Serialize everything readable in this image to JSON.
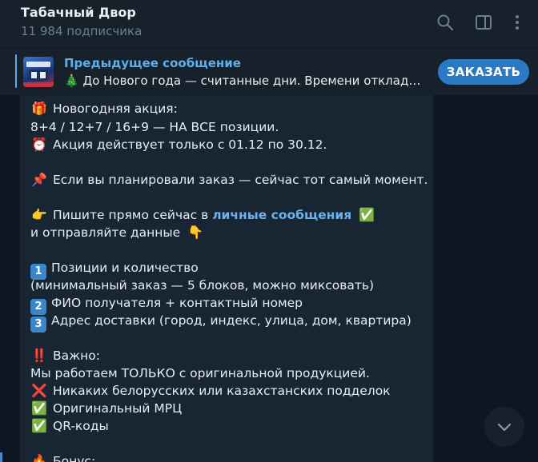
{
  "header": {
    "channel_name": "Табачный Двор",
    "subscribers": "11 984 подписчика",
    "icons": [
      "search-icon",
      "sidebar-toggle-icon",
      "more-vertical-icon"
    ]
  },
  "pinned": {
    "title": "Предыдущее сообщение",
    "emoji": "🎄",
    "preview": "До Нового года — считанные дни. Времени откладывать больше нет",
    "button": "ЗАКАЗАТЬ"
  },
  "message": {
    "l1": {
      "emoji": "🎁",
      "text": "Новогодняя акция:"
    },
    "l2": {
      "text": "8+4 / 12+7 / 16+9 — НА ВСЕ позиции."
    },
    "l3": {
      "emoji": "⏰",
      "text": "Акция действует только с 01.12 по 30.12."
    },
    "l4": {
      "emoji": "📌",
      "text": "Если вы планировали заказ — сейчас тот самый момент."
    },
    "l5": {
      "emoji": "👉",
      "text": "Пишите прямо сейчас в ",
      "link": "личные сообщения",
      "tail_emoji": "✅"
    },
    "l6": {
      "text": "и отправляйте данные",
      "tail_emoji": "👇"
    },
    "l7": {
      "key": "1",
      "text": "Позиции и количество"
    },
    "l8": {
      "text": "(минимальный заказ — 5 блоков, можно миксовать)"
    },
    "l9": {
      "key": "2",
      "text": "ФИО получателя + контактный номер"
    },
    "l10": {
      "key": "3",
      "text": "Адрес доставки (город, индекс, улица, дом, квартира)"
    },
    "l11": {
      "emoji": "‼️",
      "text": "Важно:"
    },
    "l12": {
      "text": "Мы работаем ТОЛЬКО с оригинальной продукцией."
    },
    "l13": {
      "emoji": "❌",
      "text": "Никаких белорусских или казахстанских подделок"
    },
    "l14": {
      "emoji": "✅",
      "text": "Оригинальный МРЦ"
    },
    "l15": {
      "emoji": "✅",
      "text": "QR-коды"
    },
    "l16": {
      "emoji": "🔥",
      "text": "Бонус:"
    }
  },
  "colors": {
    "background": "#0e1621",
    "header": "#17212b",
    "bubble": "#182533",
    "accent": "#5eaeea",
    "button": "#2b78c4"
  }
}
